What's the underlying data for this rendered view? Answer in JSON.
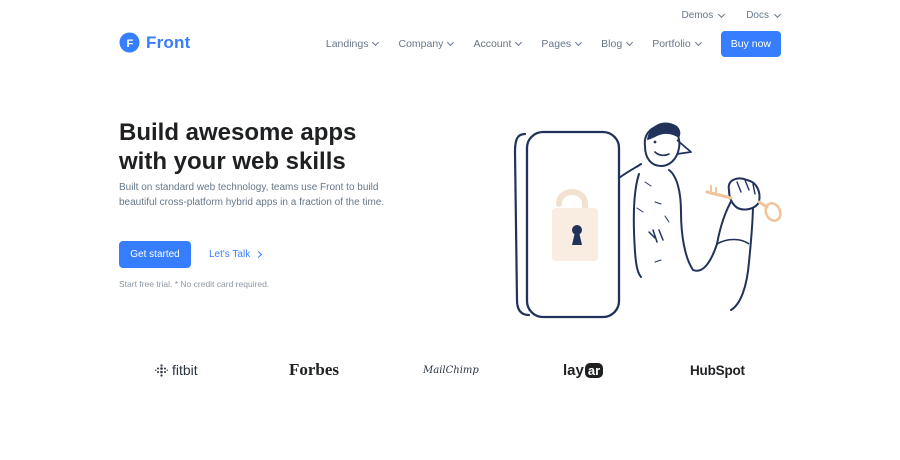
{
  "topbar": {
    "demos": "Demos",
    "docs": "Docs"
  },
  "logo": {
    "text": "Front",
    "mark": "F"
  },
  "nav": {
    "items": [
      "Landings",
      "Company",
      "Account",
      "Pages",
      "Blog",
      "Portfolio"
    ],
    "buy_label": "Buy now"
  },
  "hero": {
    "title_line1": "Build awesome apps",
    "title_line2": "with your web skills",
    "text": "Built on standard web technology, teams use Front to build beautiful cross-platform hybrid apps in a fraction of the time.",
    "primary_label": "Get started",
    "link_label": "Let's Talk",
    "hint": "Start free trial. * No credit card required."
  },
  "brands": {
    "fitbit": "fitbit",
    "forbes": "Forbes",
    "mailchimp": "MailChimp",
    "layar_prefix": "lay",
    "layar_suffix": "ar",
    "hubspot": "HubSpot"
  },
  "colors": {
    "primary": "#377dff",
    "text": "#1e2022",
    "muted": "#677788",
    "illustration": "#21325b",
    "accent": "#f0c39a"
  }
}
